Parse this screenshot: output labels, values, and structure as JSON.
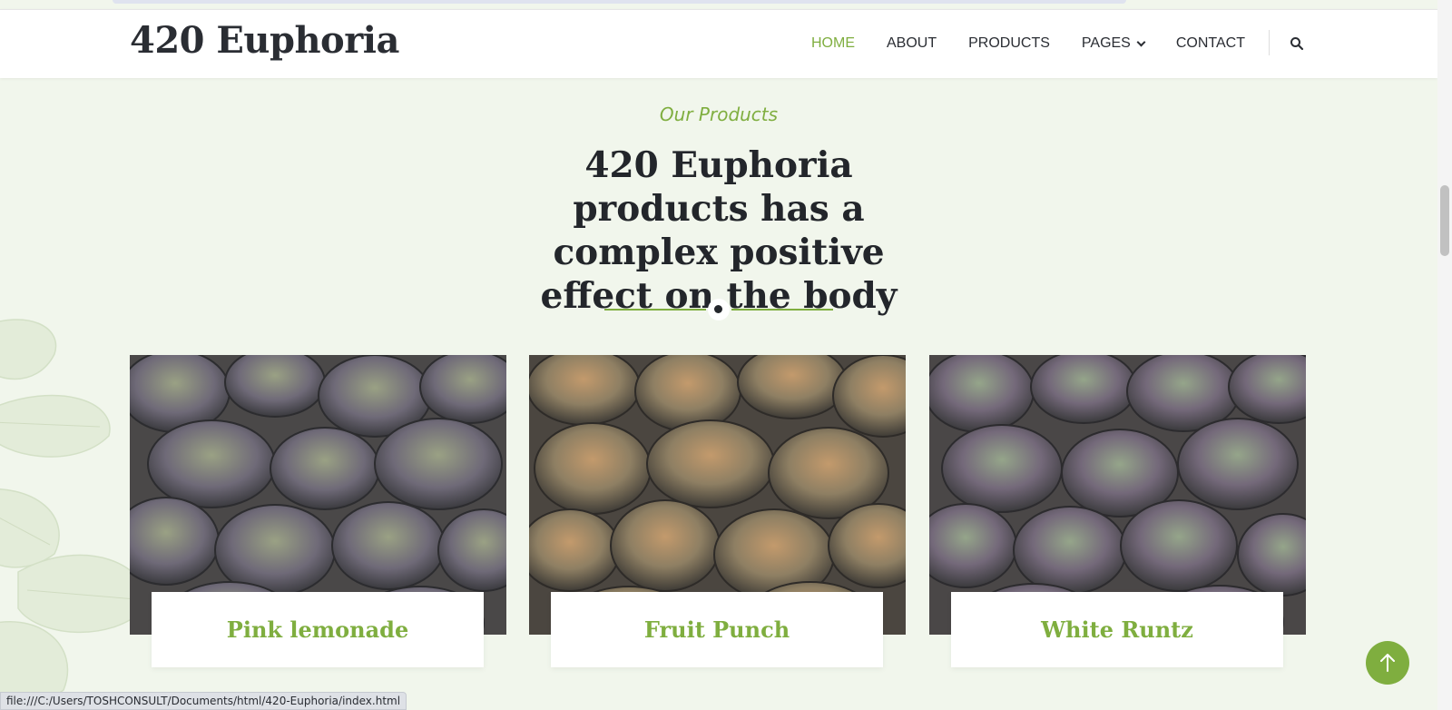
{
  "header": {
    "logo": "420 Euphoria",
    "nav": [
      {
        "label": "HOME",
        "active": true
      },
      {
        "label": "ABOUT",
        "active": false
      },
      {
        "label": "PRODUCTS",
        "active": false
      },
      {
        "label": "PAGES",
        "active": false,
        "has_dropdown": true
      },
      {
        "label": "CONTACT",
        "active": false
      }
    ],
    "search_icon": "search-icon"
  },
  "section": {
    "eyebrow": "Our Products",
    "title": "420 Euphoria products has a complex positive effect on the body"
  },
  "products": [
    {
      "name": "Pink lemonade",
      "tone": "purple-green"
    },
    {
      "name": "Fruit Punch",
      "tone": "orange-green"
    },
    {
      "name": "White Runtz",
      "tone": "green-red"
    }
  ],
  "back_to_top_icon": "arrow-up-icon",
  "status_bar": {
    "url": "file:///C:/Users/TOSHCONSULT/Documents/html/420-Euphoria/index.html"
  },
  "colors": {
    "accent": "#7fae3f",
    "heading": "#23262b",
    "background": "#f1f6ec"
  }
}
